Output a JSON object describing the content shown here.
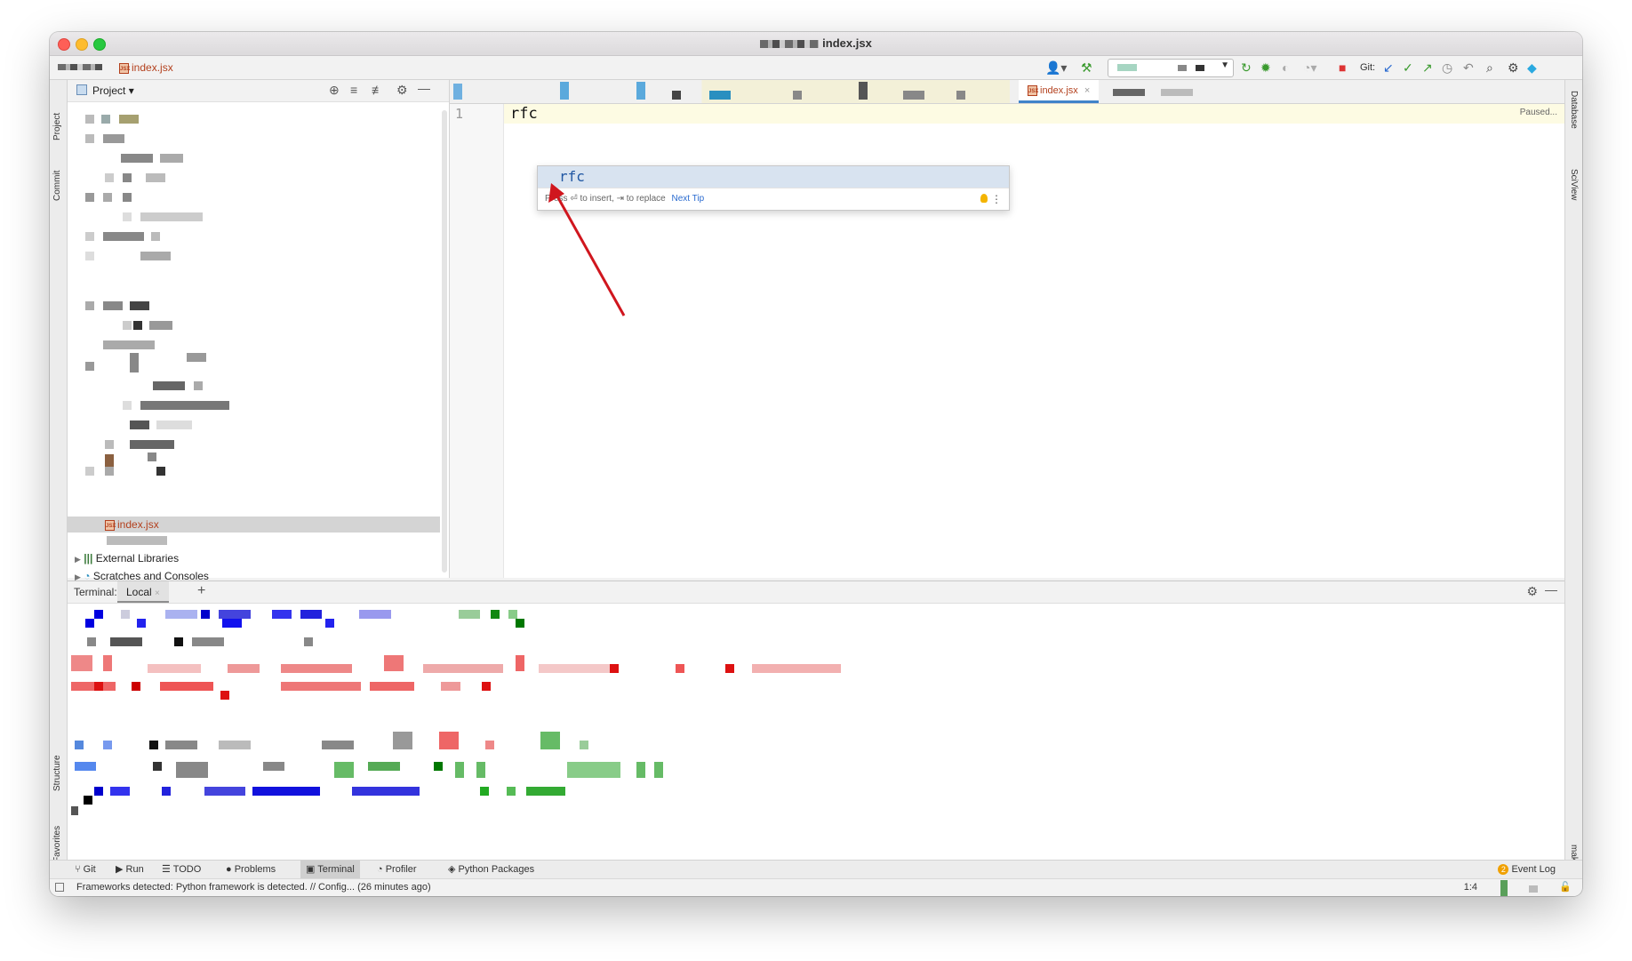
{
  "window": {
    "title": "index.jsx"
  },
  "navbar": {
    "file": "index.jsx",
    "git_label": "Git:"
  },
  "left_strip": {
    "project": "Project",
    "commit": "Commit",
    "structure": "Structure",
    "favorites": "Favorites"
  },
  "right_strip": {
    "database": "Database",
    "sciview": "SciView",
    "make": "make"
  },
  "project_panel": {
    "title": "Project",
    "selected_file": "index.jsx",
    "external_libraries": "External Libraries",
    "scratches": "Scratches and Consoles"
  },
  "editor": {
    "tab": "index.jsx",
    "line_number": "1",
    "code": "rfc",
    "status": "Paused...",
    "completion": {
      "item": "rfc",
      "hint": "Press ⏎ to insert, ⇥ to replace",
      "next_tip": "Next Tip"
    }
  },
  "terminal": {
    "label": "Terminal:",
    "tab": "Local",
    "add": "+"
  },
  "bottom_tools": [
    "Git",
    "Run",
    "TODO",
    "Problems",
    "Terminal",
    "Profiler",
    "Python Packages"
  ],
  "event_log": {
    "count": "2",
    "label": "Event Log"
  },
  "status": {
    "message": "Frameworks detected: Python framework is detected. // Config... (26 minutes ago)",
    "position": "1:4"
  },
  "colors": {
    "accent": "#4083c9",
    "jsx": "#b3401d",
    "arrow": "#d0161e",
    "completion_bg": "#d8e3f0"
  }
}
